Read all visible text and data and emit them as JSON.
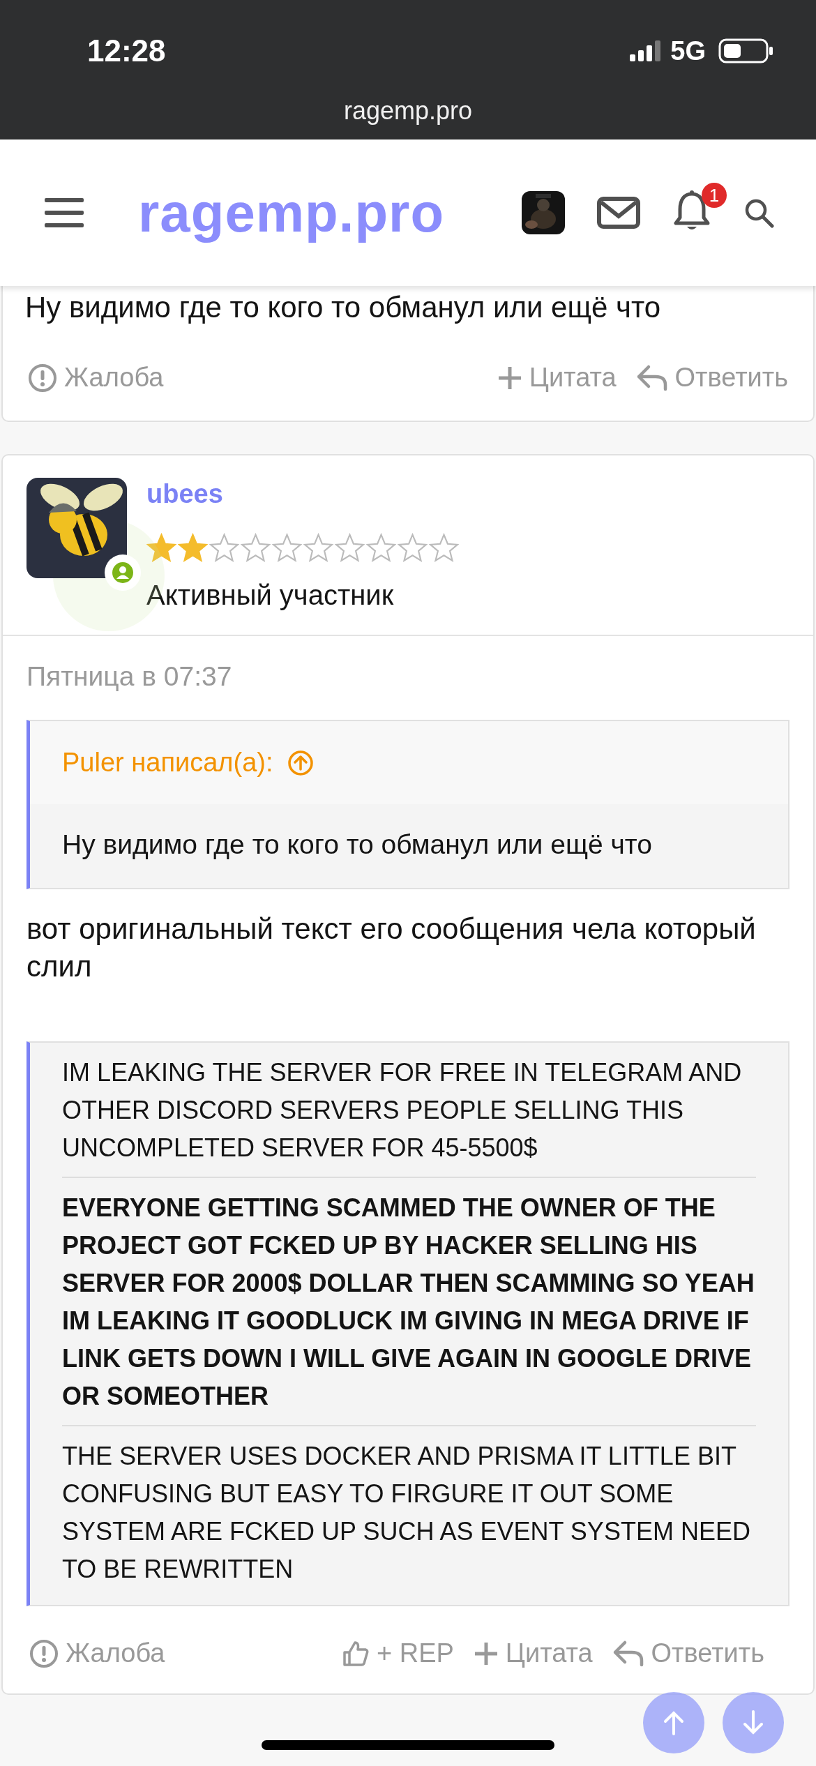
{
  "status_bar": {
    "time": "12:28",
    "network": "5G"
  },
  "browser": {
    "url": "ragemp.pro"
  },
  "header": {
    "logo": "ragemp.pro",
    "notifications_badge": "1"
  },
  "previous_post": {
    "text": "Ну видимо где то кого то обманул или ещё что",
    "actions": [
      {
        "kind": "report",
        "label": "Жалоба"
      },
      {
        "kind": "quote",
        "label": "Цитата"
      },
      {
        "kind": "reply",
        "label": "Ответить"
      }
    ]
  },
  "post": {
    "author": "ubees",
    "stars": 2,
    "role": "Активный участник",
    "online": true,
    "date": "Пятница в 07:37",
    "quote": {
      "attribution": "Puler написал(а):",
      "text": "Ну видимо где то кого то обманул или ещё что"
    },
    "text": "вот оригинальный текст его сообщения чела который слил",
    "block_quote": [
      {
        "text": "IM LEAKING THE SERVER FOR FREE IN TELEGRAM AND OTHER DISCORD SERVERS PEOPLE SELLING THIS UNCOMPLETED SERVER FOR 45-5500$",
        "bold": false
      },
      {
        "text": "EVERYONE GETTING SCAMMED THE OWNER OF THE PROJECT GOT FCKED UP BY HACKER SELLING HIS SERVER FOR 2000$ DOLLAR THEN SCAMMING SO YEAH IM LEAKING IT GOODLUCK IM GIVING IN MEGA DRIVE IF LINK GETS DOWN I WILL GIVE AGAIN IN GOOGLE DRIVE OR SOMEOTHER",
        "bold": true
      },
      {
        "text": "THE SERVER USES DOCKER AND PRISMA IT LITTLE BIT CONFUSING BUT EASY TO FIRGURE IT OUT SOME SYSTEM ARE FCKED UP SUCH AS EVENT SYSTEM NEED TO BE REWRITTEN",
        "bold": false
      }
    ],
    "actions": [
      {
        "kind": "report",
        "label": "Жалоба"
      },
      {
        "kind": "like",
        "label": "+ REP"
      },
      {
        "kind": "quote",
        "label": "Цитата"
      },
      {
        "kind": "reply",
        "label": "Ответить"
      }
    ]
  }
}
